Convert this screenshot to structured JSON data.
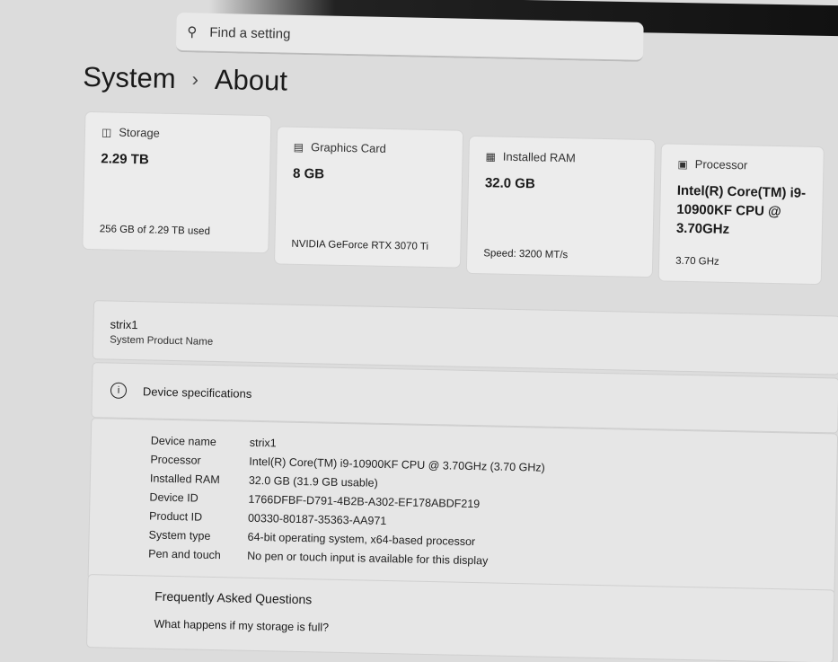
{
  "search": {
    "placeholder": "Find a setting",
    "icon": "search-icon"
  },
  "breadcrumb": {
    "parent": "System",
    "current": "About"
  },
  "cards": [
    {
      "icon": "storage-icon",
      "title": "Storage",
      "value": "2.29 TB",
      "sub": "256 GB of 2.29 TB used"
    },
    {
      "icon": "graphics-card-icon",
      "title": "Graphics Card",
      "value": "8 GB",
      "sub": "NVIDIA GeForce RTX 3070 Ti"
    },
    {
      "icon": "ram-icon",
      "title": "Installed RAM",
      "value": "32.0 GB",
      "sub": "Speed: 3200 MT/s"
    },
    {
      "icon": "processor-icon",
      "title": "Processor",
      "value": "Intel(R) Core(TM) i9-10900KF CPU @ 3.70GHz",
      "sub": "3.70 GHz"
    }
  ],
  "product": {
    "name": "strix1",
    "label": "System Product Name"
  },
  "device_specs": {
    "title": "Device specifications",
    "rows": [
      {
        "k": "Device name",
        "v": "strix1"
      },
      {
        "k": "Processor",
        "v": "Intel(R) Core(TM) i9-10900KF CPU @ 3.70GHz (3.70 GHz)"
      },
      {
        "k": "Installed RAM",
        "v": "32.0 GB (31.9 GB usable)"
      },
      {
        "k": "Device ID",
        "v": "1766DFBF-D791-4B2B-A302-EF178ABDF219"
      },
      {
        "k": "Product ID",
        "v": "00330-80187-35363-AA971"
      },
      {
        "k": "System type",
        "v": "64-bit operating system, x64-based processor"
      },
      {
        "k": "Pen and touch",
        "v": "No pen or touch input is available for this display"
      }
    ]
  },
  "faq": {
    "title": "Frequently Asked Questions",
    "q1": "What happens if my storage is full?"
  }
}
